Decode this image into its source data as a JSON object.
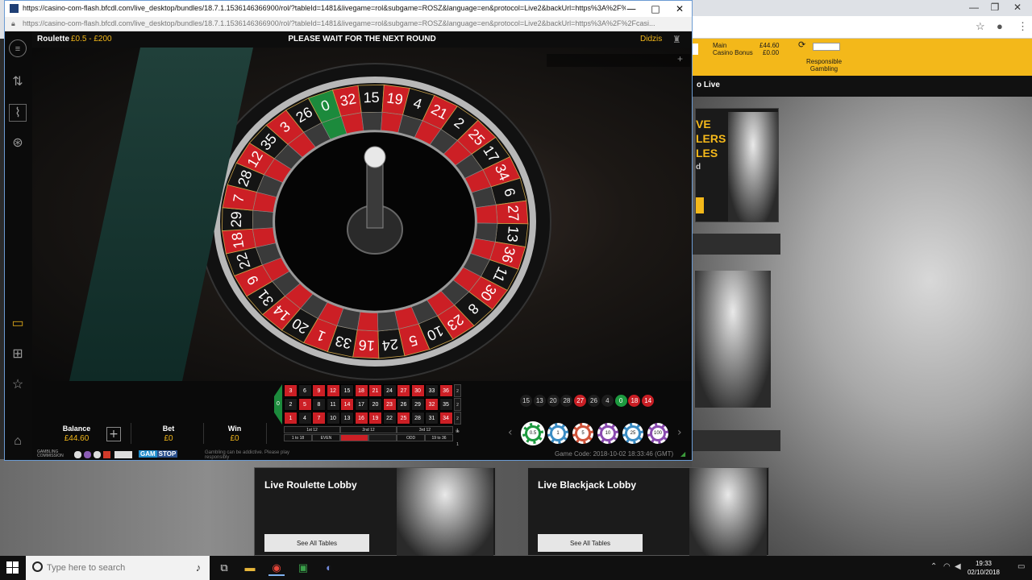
{
  "window": {
    "title": "https://casino-com-flash.bfcdl.com/live_desktop/bundles/18.7.1.1536146366900/rol/?tableId=1481&livegame=rol&subgame=ROSZ&language=en&protocol=Live2&backUrl=https%3A%2F%2Fcasino-com-flas...",
    "url": "https://casino-com-flash.bfcdl.com/live_desktop/bundles/18.7.1.1536146366900/rol/?tableId=1481&livegame=rol&subgame=ROSZ&language=en&protocol=Live2&backUrl=https%3A%2F%2Fcasi...",
    "minimize": "—",
    "maximize": "□",
    "close": "✕"
  },
  "game": {
    "name": "Roulette",
    "limits": "£0.5 - £200",
    "message": "PLEASE WAIT FOR THE NEXT ROUND",
    "user": "Didzis",
    "balance_label": "Balance",
    "balance_value": "£44.60",
    "bet_label": "Bet",
    "bet_value": "£0",
    "win_label": "Win",
    "win_value": "£0",
    "game_code": "Game Code: 2018-10-02 18:33:46 (GMT)",
    "add_funds": "+"
  },
  "history": [
    {
      "n": "15",
      "c": "black"
    },
    {
      "n": "13",
      "c": "black"
    },
    {
      "n": "20",
      "c": "black"
    },
    {
      "n": "28",
      "c": "black"
    },
    {
      "n": "27",
      "c": "red"
    },
    {
      "n": "26",
      "c": "black"
    },
    {
      "n": "4",
      "c": "black"
    },
    {
      "n": "0",
      "c": "green"
    },
    {
      "n": "18",
      "c": "red"
    },
    {
      "n": "14",
      "c": "red"
    }
  ],
  "chips": [
    {
      "label": "0.5",
      "color": "#1d9a3f",
      "selected": true
    },
    {
      "label": "1",
      "color": "#3a8cc4",
      "selected": false
    },
    {
      "label": "5",
      "color": "#d0543a",
      "selected": false
    },
    {
      "label": "10",
      "color": "#8a4ab0",
      "selected": false
    },
    {
      "label": "25",
      "color": "#3a8cc4",
      "selected": false
    },
    {
      "label": "100",
      "color": "#8a4ab0",
      "selected": false
    }
  ],
  "table_grid": {
    "zero": "0",
    "rows": [
      [
        {
          "n": "3",
          "c": "red"
        },
        {
          "n": "6",
          "c": "black"
        },
        {
          "n": "9",
          "c": "red"
        },
        {
          "n": "12",
          "c": "red"
        },
        {
          "n": "15",
          "c": "black"
        },
        {
          "n": "18",
          "c": "red"
        },
        {
          "n": "21",
          "c": "red"
        },
        {
          "n": "24",
          "c": "black"
        },
        {
          "n": "27",
          "c": "red"
        },
        {
          "n": "30",
          "c": "red"
        },
        {
          "n": "33",
          "c": "black"
        },
        {
          "n": "36",
          "c": "red"
        }
      ],
      [
        {
          "n": "2",
          "c": "black"
        },
        {
          "n": "5",
          "c": "red"
        },
        {
          "n": "8",
          "c": "black"
        },
        {
          "n": "11",
          "c": "black"
        },
        {
          "n": "14",
          "c": "red"
        },
        {
          "n": "17",
          "c": "black"
        },
        {
          "n": "20",
          "c": "black"
        },
        {
          "n": "23",
          "c": "red"
        },
        {
          "n": "26",
          "c": "black"
        },
        {
          "n": "29",
          "c": "black"
        },
        {
          "n": "32",
          "c": "red"
        },
        {
          "n": "35",
          "c": "black"
        }
      ],
      [
        {
          "n": "1",
          "c": "red"
        },
        {
          "n": "4",
          "c": "black"
        },
        {
          "n": "7",
          "c": "red"
        },
        {
          "n": "10",
          "c": "black"
        },
        {
          "n": "13",
          "c": "black"
        },
        {
          "n": "16",
          "c": "red"
        },
        {
          "n": "19",
          "c": "red"
        },
        {
          "n": "22",
          "c": "black"
        },
        {
          "n": "25",
          "c": "red"
        },
        {
          "n": "28",
          "c": "black"
        },
        {
          "n": "31",
          "c": "black"
        },
        {
          "n": "34",
          "c": "red"
        }
      ]
    ],
    "column_bets": [
      "2 to 1",
      "2 to 1",
      "2 to 1"
    ],
    "dozens": [
      "1st 12",
      "2nd 12",
      "3rd 12"
    ],
    "outside": [
      "1 to 18",
      "EVEN",
      "",
      "",
      "ODD",
      "19 to 36"
    ]
  },
  "wheel": {
    "numbers": [
      "0",
      "32",
      "15",
      "19",
      "4",
      "21",
      "2",
      "25",
      "17",
      "34",
      "6",
      "27",
      "13",
      "36",
      "11",
      "30",
      "8",
      "23",
      "10",
      "5",
      "24",
      "16",
      "33",
      "1",
      "20",
      "14",
      "31",
      "9",
      "22",
      "18",
      "29",
      "7",
      "28",
      "12",
      "35",
      "3",
      "26"
    ]
  },
  "chat": {
    "placeholder": "",
    "add": "+"
  },
  "regulatory": {
    "commission": "GAMBLING COMMISSION",
    "gamstop_1": "GAM",
    "gamstop_2": "STOP",
    "addictive": "Gambling can be addictive. Please play responsibly"
  },
  "site": {
    "main_label": "Main",
    "bonus_label": "Casino Bonus",
    "main_value": "£44.60",
    "bonus_value": "£0.00",
    "responsible": "Responsible Gambling",
    "nav_live": "o Live",
    "promo_lines": [
      "VE",
      "LERS",
      "LES",
      "d"
    ],
    "cards": [
      {
        "title": "Live Roulette Lobby",
        "button": "See All Tables"
      },
      {
        "title": "Live Blackjack Lobby",
        "button": "See All Tables"
      }
    ]
  },
  "taskbar": {
    "search_placeholder": "Type here to search",
    "time": "19:33",
    "date": "02/10/2018"
  },
  "colors": {
    "accent": "#f3b81a",
    "red": "#cc1f25",
    "green": "#1c8a3c"
  }
}
